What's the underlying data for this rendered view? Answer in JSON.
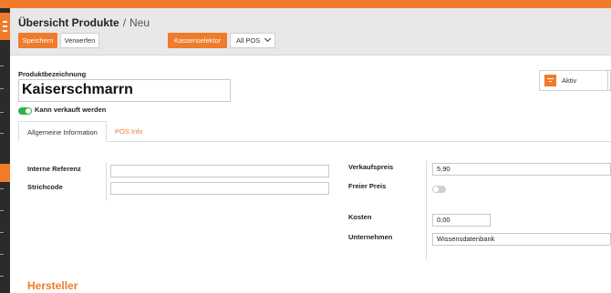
{
  "colors": {
    "accent": "#f07b2a",
    "sidebar": "#2b2b2b",
    "toggle_on": "#2db34a",
    "header_bg": "#e8e8e8"
  },
  "breadcrumb": {
    "parent": "Übersicht Produkte",
    "separator": "/",
    "current": "Neu"
  },
  "toolbar": {
    "save_label": "Speichern",
    "discard_label": "Verwerfen",
    "kassenselektor_label": "Kassenselektor",
    "pos_select_value": "All POS"
  },
  "product": {
    "name_label": "Produktbezeichnung",
    "name_value": "Kaiserschmarrn",
    "can_sell_label": "Kann verkauft werden",
    "can_sell": true
  },
  "status_button": {
    "label": "Aktiv",
    "icon": "archive-icon"
  },
  "tabs": [
    {
      "label": "Allgemeine Information",
      "active": true
    },
    {
      "label": "POS Info",
      "active": false
    }
  ],
  "form_left": {
    "internal_ref_label": "Interne Referenz",
    "internal_ref_value": "",
    "barcode_label": "Strichcode",
    "barcode_value": ""
  },
  "form_right": {
    "sale_price_label": "Verkaufspreis",
    "sale_price_value": "5,90",
    "free_price_label": "Freier Preis",
    "free_price": false,
    "cost_label": "Kosten",
    "cost_value": "0,00",
    "company_label": "Unternehmen",
    "company_value": "Wissensdatenbank"
  },
  "manufacturer_section": {
    "title": "Hersteller"
  }
}
